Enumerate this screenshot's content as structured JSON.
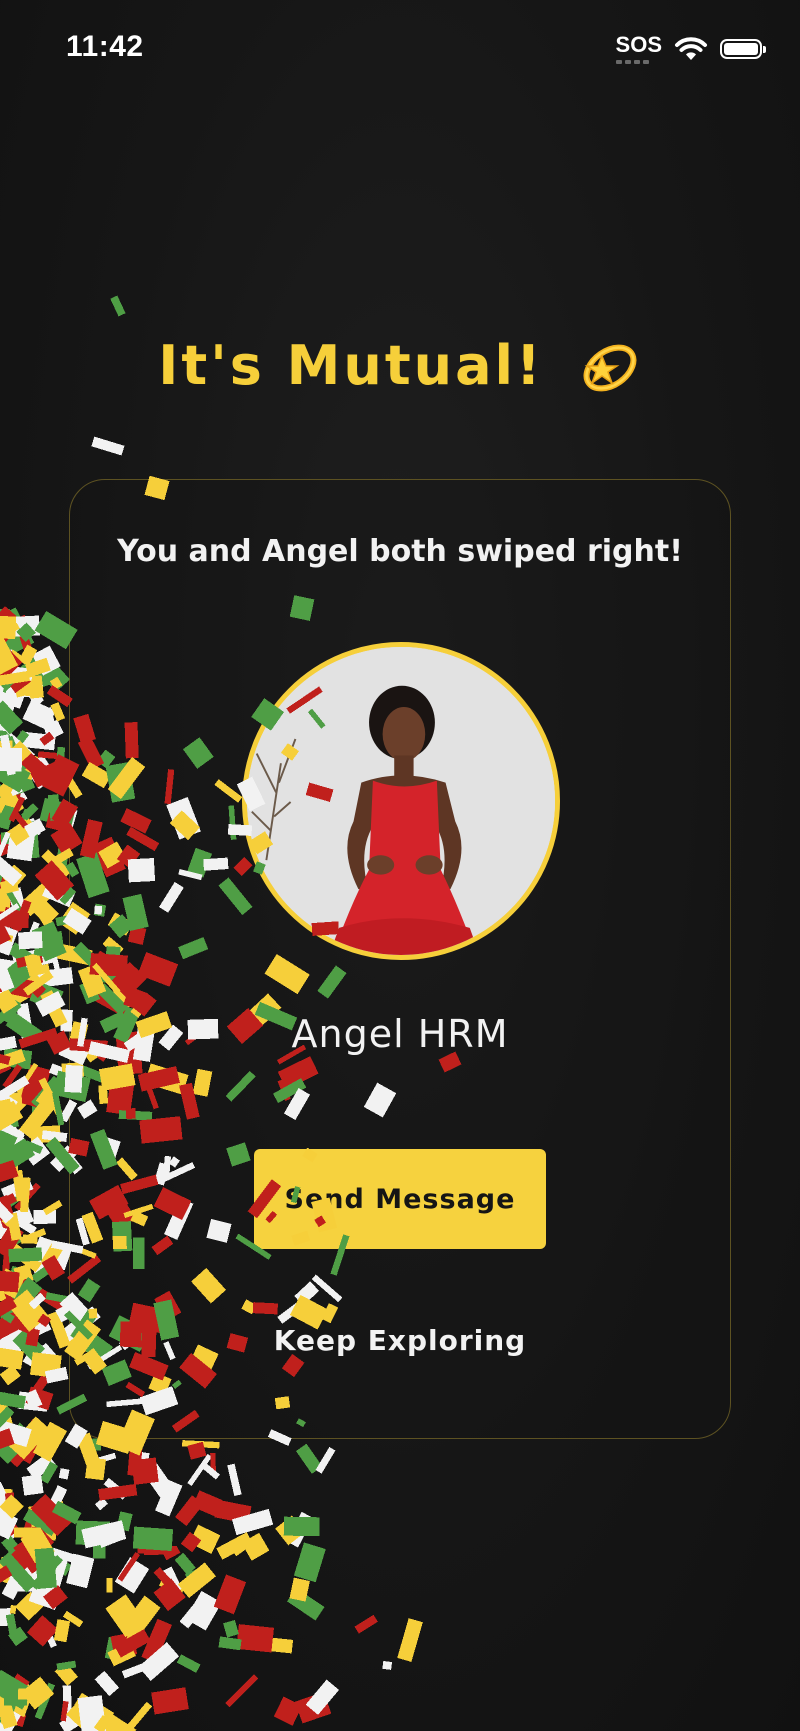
{
  "status_bar": {
    "time": "11:42",
    "sos_label": "SOS",
    "battery_level": 1.0
  },
  "match": {
    "title": "It's Mutual!",
    "title_emoji": "dizzy-star-icon",
    "subtitle": "You and Angel both swiped right!",
    "profile_name": "Angel HRM",
    "send_message_label": "Send Message",
    "keep_exploring_label": "Keep Exploring"
  },
  "colors": {
    "accent": "#f6cf3a",
    "background": "#161616",
    "card_border": "#5d5222",
    "button_text": "#151515",
    "confetti": [
      "#f6cf3a",
      "#c0201c",
      "#4f9e45",
      "#f2f2f2"
    ]
  }
}
